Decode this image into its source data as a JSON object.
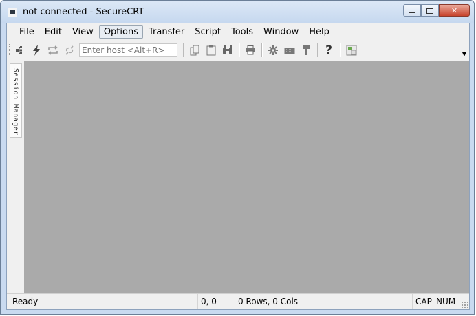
{
  "window": {
    "title": "not connected - SecureCRT",
    "icon": "securecrt-app-icon"
  },
  "menubar": {
    "items": [
      {
        "label": "File"
      },
      {
        "label": "Edit"
      },
      {
        "label": "View"
      },
      {
        "label": "Options",
        "active": true
      },
      {
        "label": "Transfer"
      },
      {
        "label": "Script"
      },
      {
        "label": "Tools"
      },
      {
        "label": "Window"
      },
      {
        "label": "Help"
      }
    ]
  },
  "toolbar": {
    "host_placeholder": "Enter host <Alt+R>",
    "buttons": [
      {
        "name": "connect-in-tab-icon",
        "glyph": "⇶"
      },
      {
        "name": "quick-connect-icon",
        "glyph": "⚡"
      },
      {
        "name": "reconnect-icon",
        "glyph": "⇄"
      },
      {
        "name": "disconnect-icon",
        "glyph": "∞"
      },
      {
        "name": "copy-icon",
        "glyph": "❐"
      },
      {
        "name": "paste-icon",
        "glyph": "📋"
      },
      {
        "name": "find-icon",
        "glyph": "⌕"
      },
      {
        "name": "print-icon",
        "glyph": "⎙"
      },
      {
        "name": "session-options-icon",
        "glyph": "⚙"
      },
      {
        "name": "keymap-icon",
        "glyph": "⌨"
      },
      {
        "name": "sftp-icon",
        "glyph": "⚷"
      },
      {
        "name": "help-icon",
        "glyph": "?"
      },
      {
        "name": "screenshot-icon",
        "glyph": "▣"
      }
    ]
  },
  "sidebar": {
    "session_manager_label": "Session Manager"
  },
  "statusbar": {
    "ready": "Ready",
    "position": "0, 0",
    "dimensions": "0 Rows, 0 Cols",
    "cap": "CAP",
    "num": "NUM"
  },
  "colors": {
    "terminal_bg": "#aaaaaa",
    "titlebar": "#c9daf0",
    "close_button": "#c8442d"
  }
}
